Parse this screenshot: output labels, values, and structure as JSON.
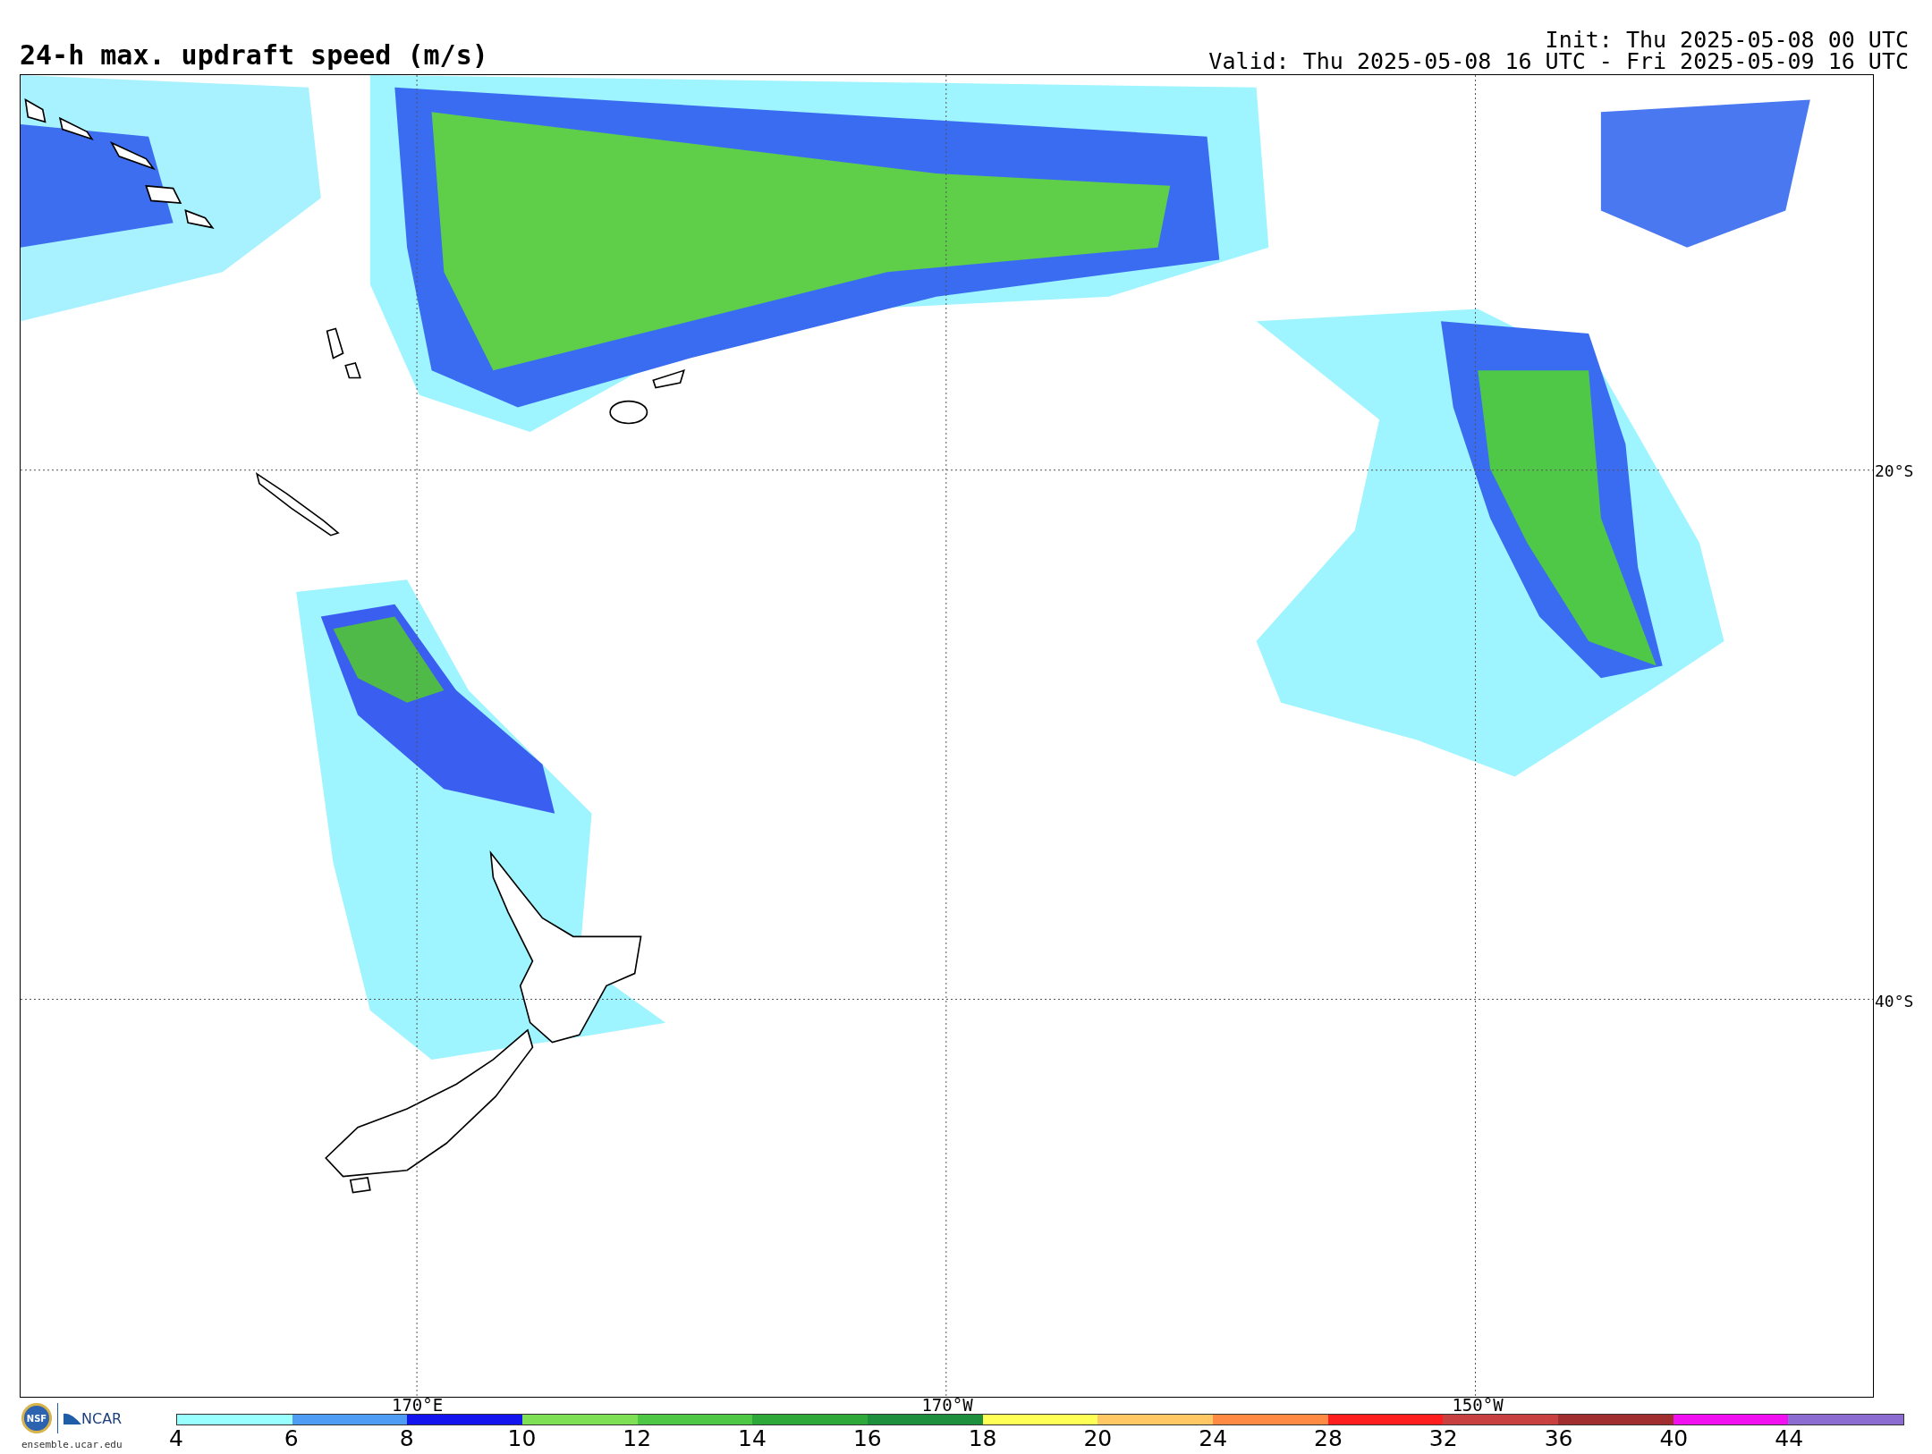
{
  "title": "24-h max. updraft speed (m/s)",
  "init": "Init: Thu 2025-05-08 00 UTC",
  "valid": "Valid: Thu 2025-05-08 16 UTC - Fri 2025-05-09 16 UTC",
  "map": {
    "latitude_labels": [
      "20°S",
      "40°S"
    ],
    "longitude_labels": [
      "170°E",
      "170°W",
      "150°W"
    ]
  },
  "logos": {
    "nsf": "NSF",
    "ncar": "NCAR",
    "site": "ensemble.ucar.edu"
  },
  "colorbar": {
    "segments": [
      {
        "color": "#99ffff",
        "label": "4"
      },
      {
        "color": "#4f9cf5",
        "label": "6"
      },
      {
        "color": "#1414ee",
        "label": "8"
      },
      {
        "color": "#7ee054",
        "label": "10"
      },
      {
        "color": "#4ec844",
        "label": "12"
      },
      {
        "color": "#2ea838",
        "label": "14"
      },
      {
        "color": "#1e8f3c",
        "label": "16"
      },
      {
        "color": "#ffff55",
        "label": "18"
      },
      {
        "color": "#ffc864",
        "label": "20"
      },
      {
        "color": "#ff8a44",
        "label": "24"
      },
      {
        "color": "#ff1e1e",
        "label": "28"
      },
      {
        "color": "#c84040",
        "label": "32"
      },
      {
        "color": "#a02e2e",
        "label": "36"
      },
      {
        "color": "#f010f0",
        "label": "40"
      },
      {
        "color": "#8c6cd0",
        "label": "44"
      }
    ]
  }
}
